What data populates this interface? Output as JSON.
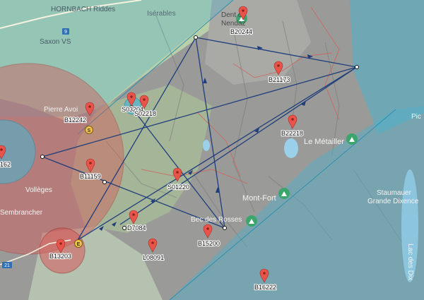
{
  "map": {
    "place_labels": {
      "hornbach": "HORNBACH Riddes",
      "isérables": "Isérables",
      "dent_de_nendaz_1": "Dent de",
      "dent_de_nendaz_2": "Nendaz",
      "saxon": "Saxon VS",
      "pierre_avoi": "Pierre Avoi",
      "volleges": "Vollèges",
      "sembrancher": "Sembrancher",
      "le_metailler": "Le Métailler",
      "mont_fort": "Mont-Fort",
      "staumauer_1": "Staumauer",
      "staumauer_2": "Grande Dixence",
      "lac_des_dix": "Lac des Dix",
      "bec_des_rosses": "Bec des Rosses",
      "pic": "Pic"
    },
    "road_shields": {
      "r9": "9",
      "r21": "21"
    },
    "turnpoint_badges": {
      "s": "S",
      "e": "E"
    },
    "markers": [
      {
        "id": "b20244",
        "label": "B20244"
      },
      {
        "id": "b21173",
        "label": "B21173"
      },
      {
        "id": "b12242",
        "label": "B12242"
      },
      {
        "id": "s03204",
        "label": "S03204"
      },
      {
        "id": "s02218",
        "label": "S02218"
      },
      {
        "id": "b22218",
        "label": "B22218"
      },
      {
        "id": "m162",
        "label": "162"
      },
      {
        "id": "b11159",
        "label": "B11159"
      },
      {
        "id": "s01220",
        "label": "S01220"
      },
      {
        "id": "d7084",
        "label": "D7084"
      },
      {
        "id": "b13203",
        "label": "B13203"
      },
      {
        "id": "l08091",
        "label": "L08091"
      },
      {
        "id": "b15200",
        "label": "B15200"
      },
      {
        "id": "b16222",
        "label": "B16222"
      }
    ],
    "colors": {
      "terrain": "#8e8e8e",
      "airspace_blue": "#4fb2cc",
      "airspace_red": "#d45a5a",
      "route": "#1f3e7a",
      "marker": "#e8534a",
      "park_icon": "#3ba56b"
    }
  }
}
